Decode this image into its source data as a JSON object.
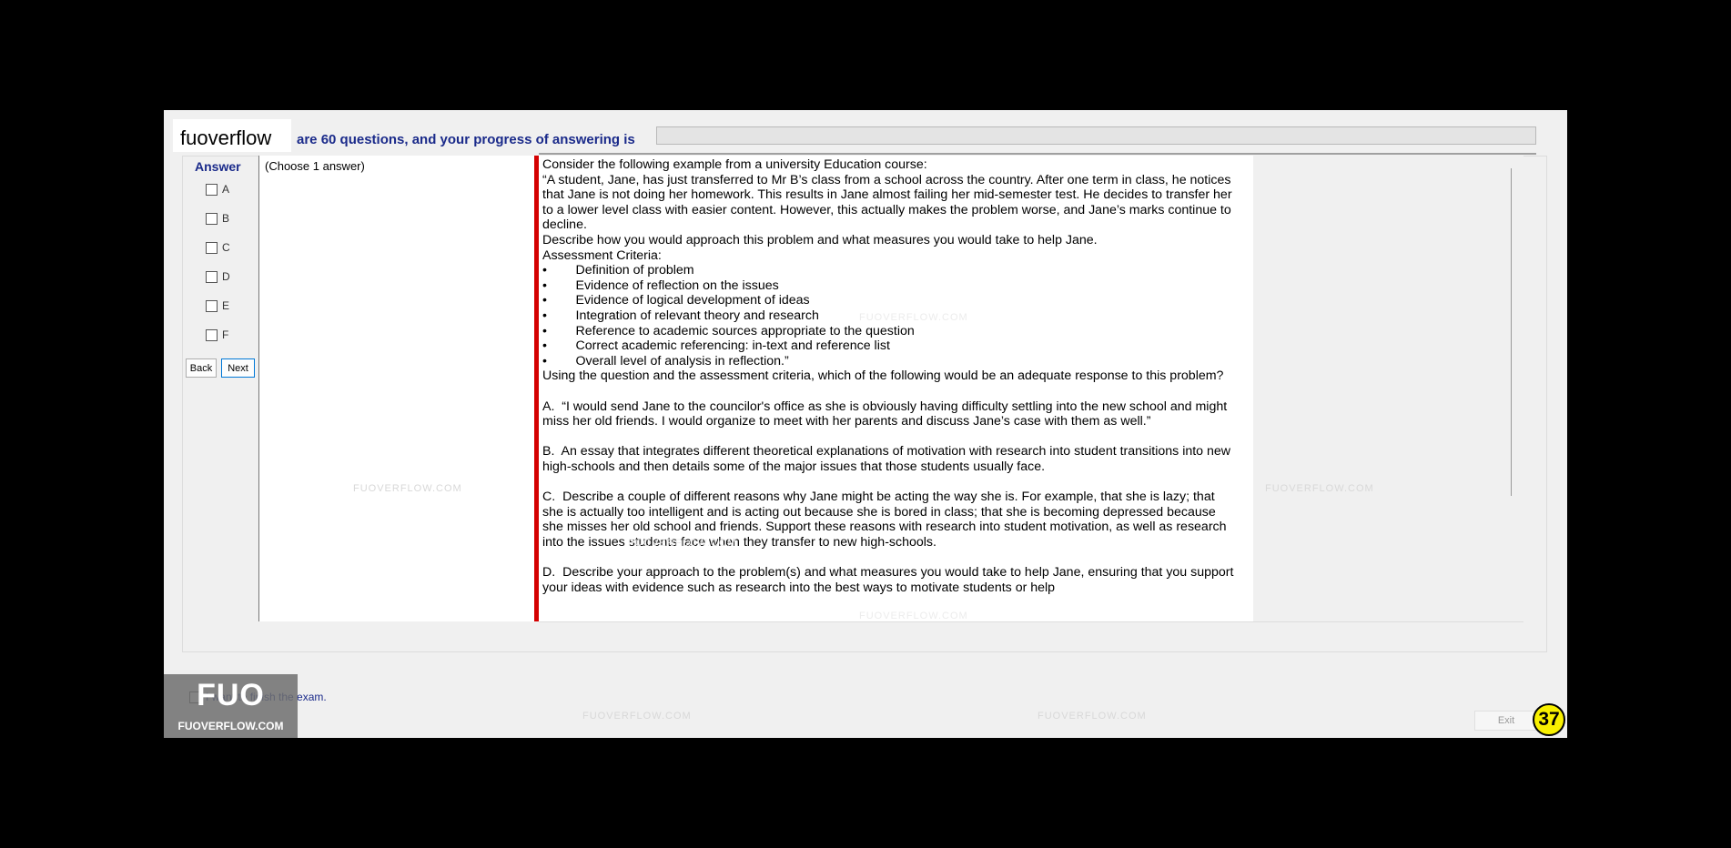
{
  "header": {
    "brand": "fuoverflow",
    "progress_text": "are 60 questions, and your progress of answering is",
    "progress": 0
  },
  "answer_panel": {
    "heading": "Answer",
    "options": [
      "A",
      "B",
      "C",
      "D",
      "E",
      "F"
    ],
    "back_label": "Back",
    "next_label": "Next"
  },
  "question": {
    "choose_label": "(Choose 1 answer)",
    "text": "Consider the following example from a university Education course:\n“A student, Jane, has just transferred to Mr B’s class from a school across the country. After one term in class, he notices that Jane is not doing her homework. This results in Jane almost failing her mid-semester test. He decides to transfer her to a lower level class with easier content. However, this actually makes the problem worse, and Jane’s marks continue to decline.\nDescribe how you would approach this problem and what measures you would take to help Jane.\nAssessment Criteria:\n•        Definition of problem\n•        Evidence of reflection on the issues\n•        Evidence of logical development of ideas\n•        Integration of relevant theory and research\n•        Reference to academic sources appropriate to the question\n•        Correct academic referencing: in-text and reference list\n•        Overall level of analysis in reflection.”\nUsing the question and the assessment criteria, which of the following would be an adequate response to this problem?\n\nA.  “I would send Jane to the councilor's office as she is obviously having difficulty settling into the new school and might miss her old friends. I would organize to meet with her parents and discuss Jane’s case with them as well.”\n\nB.  An essay that integrates different theoretical explanations of motivation with research into student transitions into new high-schools and then details some of the major issues that those students usually face.\n\nC.  Describe a couple of different reasons why Jane might be acting the way she is. For example, that she is lazy; that she is actually too intelligent and is acting out because she is bored in class; that she is becoming depressed because she misses her old school and friends. Support these reasons with research into student motivation, as well as research into the issues students face when they transfer to new high-schools.\n\nD.  Describe your approach to the problem(s) and what measures you would take to help Jane, ensuring that you support your ideas with evidence such as research into the best ways to motivate students or help"
  },
  "footer": {
    "finish_label": "I want to finish the exam.",
    "exit_label": "Exit",
    "badge": "37"
  },
  "logo": {
    "big": "FUO",
    "small": "FUOVERFLOW.COM"
  },
  "watermark": "FUOVERFLOW.COM",
  "colors": {
    "label_blue": "#1a2a8a",
    "splitter_red": "#d40000",
    "badge_yellow": "#f8f000"
  }
}
